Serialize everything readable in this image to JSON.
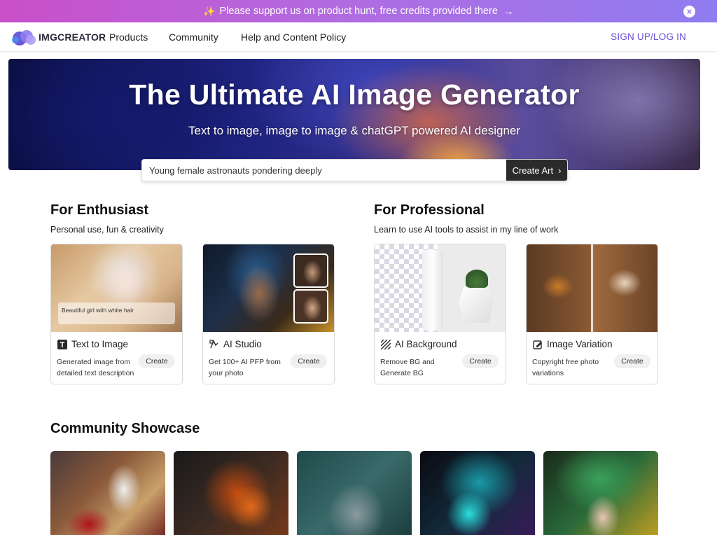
{
  "promo": {
    "text": "Please support us on product hunt, free credits provided there",
    "spark_icon": "sparkle-icon",
    "arrow_icon": "arrow-right-icon",
    "close_icon": "close-icon"
  },
  "header": {
    "logo_text": "IMGCREATOR",
    "nav": [
      "Products",
      "Community",
      "Help and Content Policy"
    ],
    "signup": "SIGN UP/LOG IN"
  },
  "hero": {
    "title": "The Ultimate AI Image Generator",
    "subtitle": "Text to image, image to image & chatGPT powered AI designer"
  },
  "search": {
    "value": "Young female astronauts pondering deeply",
    "button": "Create Art",
    "button_icon": "chevron-right-icon"
  },
  "enthusiast": {
    "title": "For Enthusiast",
    "subtitle": "Personal use, fun & creativity"
  },
  "professional": {
    "title": "For Professional",
    "subtitle": "Learn to use AI tools to assist in my line of work"
  },
  "cards": [
    {
      "title": "Text to Image",
      "desc": "Generated image from detailed text description",
      "button": "Create",
      "icon": "text-t-icon",
      "overlay": "Beautiful girl with white hair"
    },
    {
      "title": "AI Studio",
      "desc": "Get 100+ AI PFP from your photo",
      "button": "Create",
      "icon": "studio-icon"
    },
    {
      "title": "AI Background",
      "desc": "Remove BG and Generate BG",
      "button": "Create",
      "icon": "background-stripes-icon"
    },
    {
      "title": "Image Variation",
      "desc": "Copyright free photo variations",
      "button": "Create",
      "icon": "edit-icon"
    }
  ],
  "community": {
    "title": "Community Showcase"
  },
  "colors": {
    "accent": "#6a4fd6",
    "dark_button": "#2b2b2b",
    "promo_start": "#c94fc9",
    "promo_end": "#8f7df0"
  }
}
